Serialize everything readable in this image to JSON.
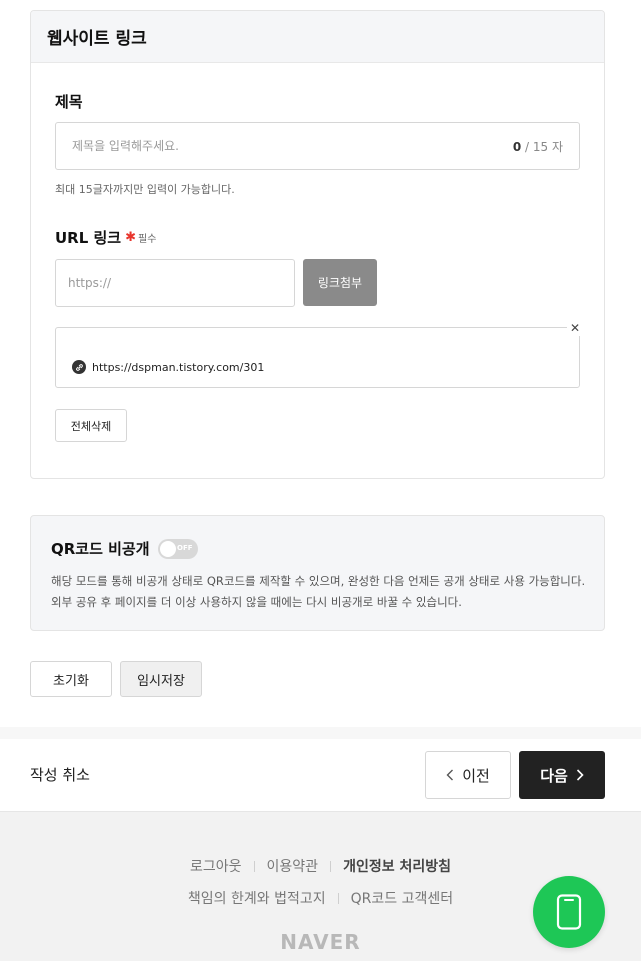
{
  "website_link": {
    "section_title": "웹사이트 링크",
    "title_label": "제목",
    "title_placeholder": "제목을 입력해주세요.",
    "title_value": "",
    "counter_current": "0",
    "counter_max": " / 15 자",
    "title_hint": "최대 15글자까지만 입력이 가능합니다.",
    "url_label": "URL 링크",
    "required_mark": "✱",
    "required_text": "필수",
    "url_placeholder": "https://",
    "attach_button": "링크첨부",
    "attached_link": "https://dspman.tistory.com/301",
    "delete_all_button": "전체삭제"
  },
  "qr": {
    "title": "QR코드 비공개",
    "toggle_state": "OFF",
    "description": "해당 모드를 통해 비공개 상태로 QR코드를 제작할 수 있으며, 완성한 다음 언제든 공개 상태로 사용 가능합니다. 외부 공유 후 페이지를 더 이상 사용하지 않을 때에는 다시 비공개로 바꿀 수 있습니다."
  },
  "actions": {
    "reset": "초기화",
    "temp_save": "임시저장",
    "cancel": "작성 취소",
    "prev": "이전",
    "next": "다음"
  },
  "footer": {
    "logout": "로그아웃",
    "terms": "이용약관",
    "privacy": "개인정보 처리방침",
    "disclaimer": "책임의 한계와 법적고지",
    "support": "QR코드 고객센터",
    "brand": "NAVER"
  },
  "colors": {
    "accent_green": "#1ec756",
    "next_button": "#222222",
    "required_red": "#e8352d"
  }
}
